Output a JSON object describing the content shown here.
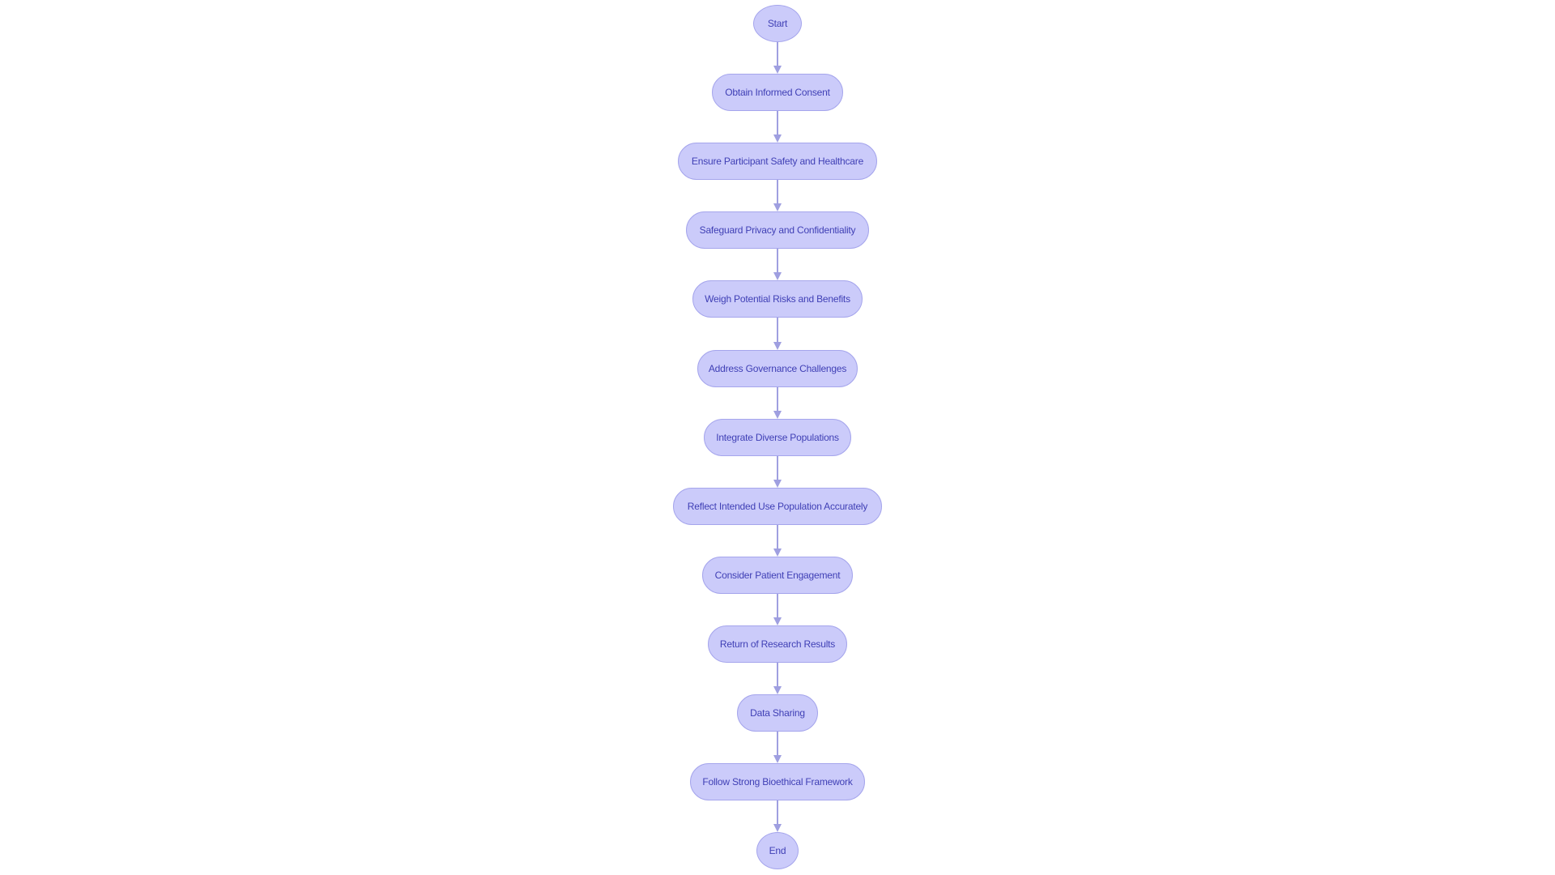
{
  "diagram": {
    "type": "flowchart",
    "direction": "top-to-bottom",
    "colors": {
      "node_fill": "#cbcbfa",
      "node_stroke": "#a5a5ec",
      "edge": "#9f9fe0",
      "text": "#3f3fb5"
    },
    "nodes": [
      {
        "id": "start",
        "label": "Start",
        "shape": "circle"
      },
      {
        "id": "consent",
        "label": "Obtain Informed Consent",
        "shape": "stadium"
      },
      {
        "id": "safety",
        "label": "Ensure Participant Safety and Healthcare",
        "shape": "stadium"
      },
      {
        "id": "privacy",
        "label": "Safeguard Privacy and Confidentiality",
        "shape": "stadium"
      },
      {
        "id": "risks",
        "label": "Weigh Potential Risks and Benefits",
        "shape": "stadium"
      },
      {
        "id": "governance",
        "label": "Address Governance Challenges",
        "shape": "stadium"
      },
      {
        "id": "diverse",
        "label": "Integrate Diverse Populations",
        "shape": "stadium"
      },
      {
        "id": "reflect",
        "label": "Reflect Intended Use Population Accurately",
        "shape": "stadium"
      },
      {
        "id": "engagement",
        "label": "Consider Patient Engagement",
        "shape": "stadium"
      },
      {
        "id": "results",
        "label": "Return of Research Results",
        "shape": "stadium"
      },
      {
        "id": "sharing",
        "label": "Data Sharing",
        "shape": "stadium"
      },
      {
        "id": "framework",
        "label": "Follow Strong Bioethical Framework",
        "shape": "stadium"
      },
      {
        "id": "end",
        "label": "End",
        "shape": "circle"
      }
    ],
    "edges": [
      {
        "from": "start",
        "to": "consent"
      },
      {
        "from": "consent",
        "to": "safety"
      },
      {
        "from": "safety",
        "to": "privacy"
      },
      {
        "from": "privacy",
        "to": "risks"
      },
      {
        "from": "risks",
        "to": "governance"
      },
      {
        "from": "governance",
        "to": "diverse"
      },
      {
        "from": "diverse",
        "to": "reflect"
      },
      {
        "from": "reflect",
        "to": "engagement"
      },
      {
        "from": "engagement",
        "to": "results"
      },
      {
        "from": "results",
        "to": "sharing"
      },
      {
        "from": "sharing",
        "to": "framework"
      },
      {
        "from": "framework",
        "to": "end"
      }
    ]
  }
}
